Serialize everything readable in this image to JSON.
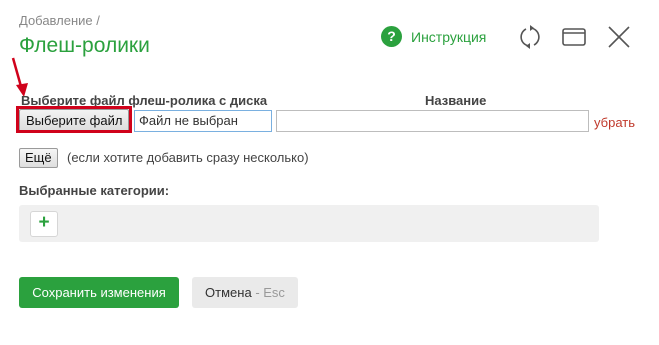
{
  "header": {
    "breadcrumb": "Добавление /",
    "title": "Флеш-ролики",
    "help_label": "Инструкция",
    "help_glyph": "?"
  },
  "icons": {
    "help": "question-circle-icon",
    "refresh": "refresh-icon",
    "maximize": "maximize-window-icon",
    "close": "close-icon",
    "annotation": "red-arrow"
  },
  "form": {
    "file_column_label": "Выберите файл флеш-ролика с диска",
    "name_column_label": "Название",
    "file_button_label": "Выберите файл",
    "file_status": "Файл не выбран",
    "name_value": "",
    "remove_label": "убрать",
    "more_button_label": "Ещё",
    "more_hint": "(если хотите добавить сразу несколько)",
    "categories_label": "Выбранные категории:",
    "add_category_glyph": "+"
  },
  "footer": {
    "save_label": "Сохранить изменения",
    "cancel_label": "Отмена",
    "cancel_hint": " - Esc"
  },
  "colors": {
    "accent": "#2ba13e",
    "annotation": "#d0021b",
    "remove_link": "#c0392b"
  }
}
